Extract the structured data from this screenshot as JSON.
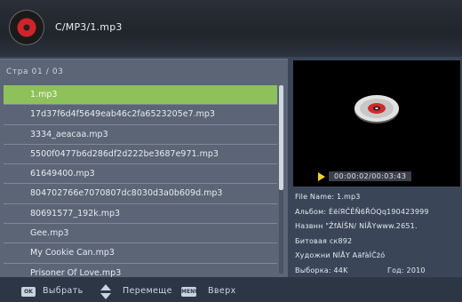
{
  "header": {
    "path": "C/MP3/1.mp3"
  },
  "list": {
    "page_label": "Стра  01 / 03",
    "items": [
      "1.mp3",
      "17d37f6d4f5649eab46c2fa6523205e7.mp3",
      "3334_aeacaa.mp3",
      "5500f0477b6d286df2d222be3687e971.mp3",
      "61649400.mp3",
      "804702766e7070807dc8030d3a0b609d.mp3",
      "80691577_192k.mp3",
      "Gee.mp3",
      "My Cookie Can.mp3",
      "Prisoner Of Love.mp3"
    ],
    "selected_index": 0
  },
  "player": {
    "time": "00:00:02/00:03:43"
  },
  "info": {
    "file_name": "File Name:   1.mp3",
    "album": "Альбом:  ÉëíЯĈÊÑ6ŘÓQq190423999",
    "title": "Назвнн \"ŽfÀĺŠN/  NÍÅYwww.2651.",
    "bitrate": "Битовая ск892",
    "artist": "Художни NİÅY AäfàÍĈżó",
    "sample": "Выборка:   44K",
    "year": "Год:  2010"
  },
  "bottom": {
    "ok_key": "OK",
    "select_label": "Выбрать",
    "move_label": "Перемеще",
    "menu_key": "MENU",
    "up_label": "Вверх"
  },
  "colors": {
    "background": "#3a4658",
    "selected_row": "#8fc15b",
    "play_icon": "#f2cf26",
    "disc_red": "#d4222a"
  }
}
